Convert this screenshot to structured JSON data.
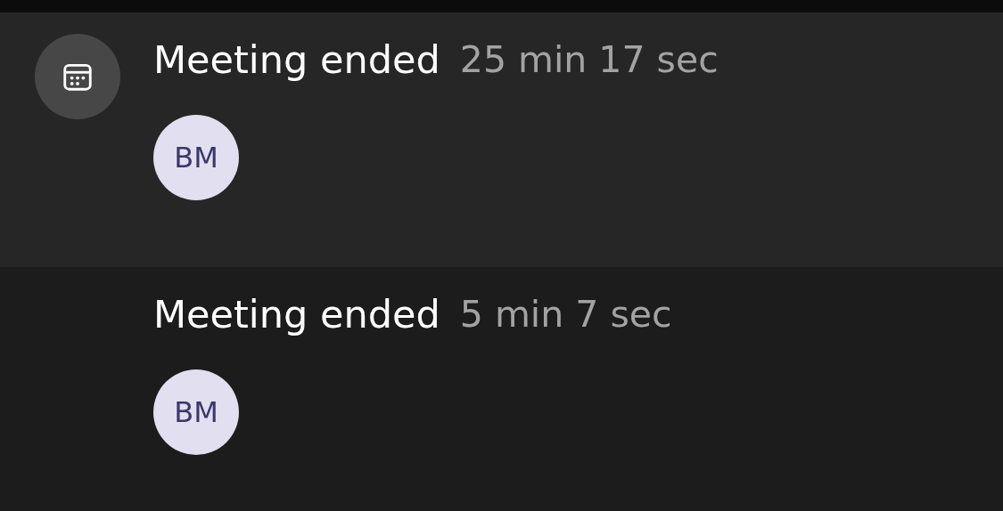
{
  "items": [
    {
      "title": "Meeting ended",
      "duration": "25 min 17 sec",
      "avatar": "BM",
      "show_icon": true
    },
    {
      "title": "Meeting ended",
      "duration": "5 min 7 sec",
      "avatar": "BM",
      "show_icon": false
    }
  ]
}
